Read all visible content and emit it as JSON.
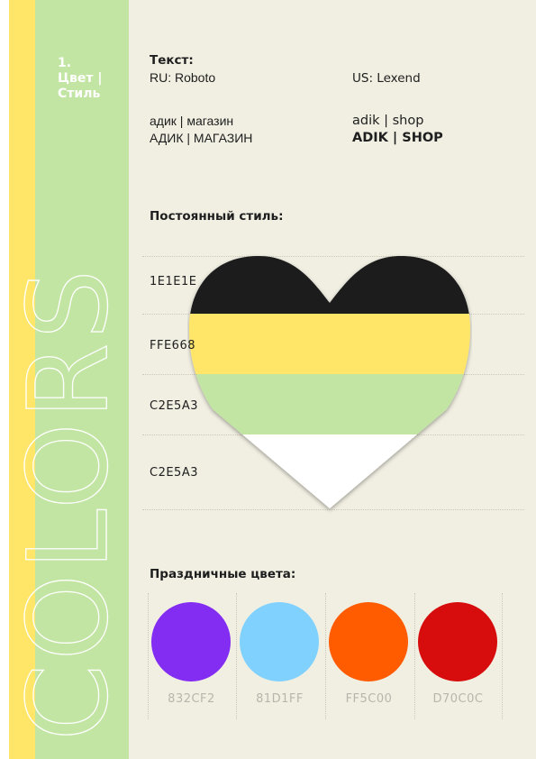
{
  "sidebar": {
    "section_number": "1.",
    "section_title_line1": "Цвет |",
    "section_title_line2": "Стиль",
    "vertical_word": "COLORS"
  },
  "text_block": {
    "heading": "Текст:",
    "ru_font": "RU: Roboto",
    "us_font": "US: Lexend",
    "ru_lower": "адик | магазин",
    "ru_upper": "АДИК | МАГАЗИН",
    "us_lower": "adik | shop",
    "us_upper": "ADIK | SHOP"
  },
  "constant_style": {
    "heading": "Постоянный стиль:",
    "colors": [
      {
        "label": "1E1E1E",
        "color": "#1e1e1e"
      },
      {
        "label": "FFE668",
        "color": "#ffe668"
      },
      {
        "label": "C2E5A3",
        "color": "#c2e5a3"
      },
      {
        "label": "C2E5A3",
        "color": "#ffffff"
      }
    ]
  },
  "holiday": {
    "heading": "Праздничные цвета:",
    "swatches": [
      {
        "label": "832CF2",
        "color": "#832cf2"
      },
      {
        "label": "81D1FF",
        "color": "#81d1ff"
      },
      {
        "label": "FF5C00",
        "color": "#ff5c00"
      },
      {
        "label": "D70C0C",
        "color": "#d70c0c"
      }
    ]
  }
}
